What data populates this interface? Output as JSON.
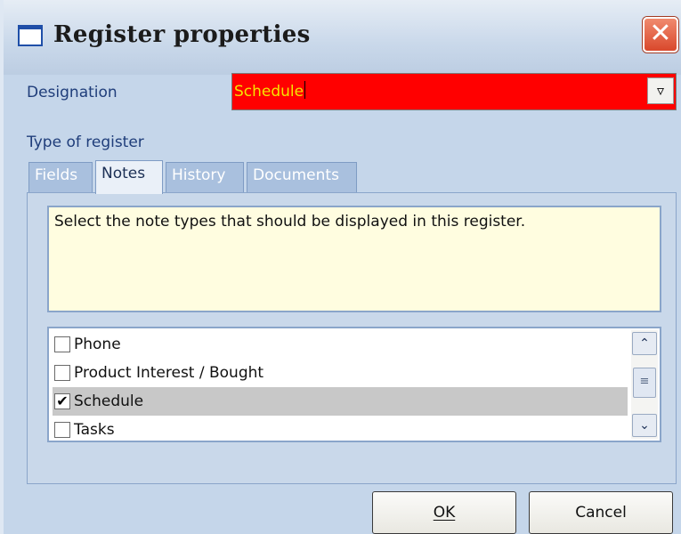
{
  "window": {
    "title": "Register properties",
    "close_symbol": "✕",
    "icon": "window-icon"
  },
  "designation": {
    "label": "Designation",
    "value": "Schedule",
    "field_bg": "#ff0000",
    "text_color": "#f5e500",
    "dropdown_symbol": "▿"
  },
  "type_label": "Type of register",
  "tabs": [
    {
      "label": "Fields",
      "active": false
    },
    {
      "label": "Notes",
      "active": true
    },
    {
      "label": "History",
      "active": false
    },
    {
      "label": "Documents",
      "active": false
    }
  ],
  "notes_panel": {
    "description": "Select the note types that should be displayed in this register.",
    "items": [
      {
        "label": "Phone",
        "checked": false,
        "selected": false
      },
      {
        "label": "Product Interest / Bought",
        "checked": false,
        "selected": false
      },
      {
        "label": "Schedule",
        "checked": true,
        "selected": true
      },
      {
        "label": "Tasks",
        "checked": false,
        "selected": false
      }
    ],
    "check_mark": "✔",
    "scroll_up_symbol": "⌃",
    "scroll_down_symbol": "⌄",
    "scroll_thumb_symbol": "≡"
  },
  "buttons": {
    "ok_label": "OK",
    "cancel_label": "Cancel"
  }
}
